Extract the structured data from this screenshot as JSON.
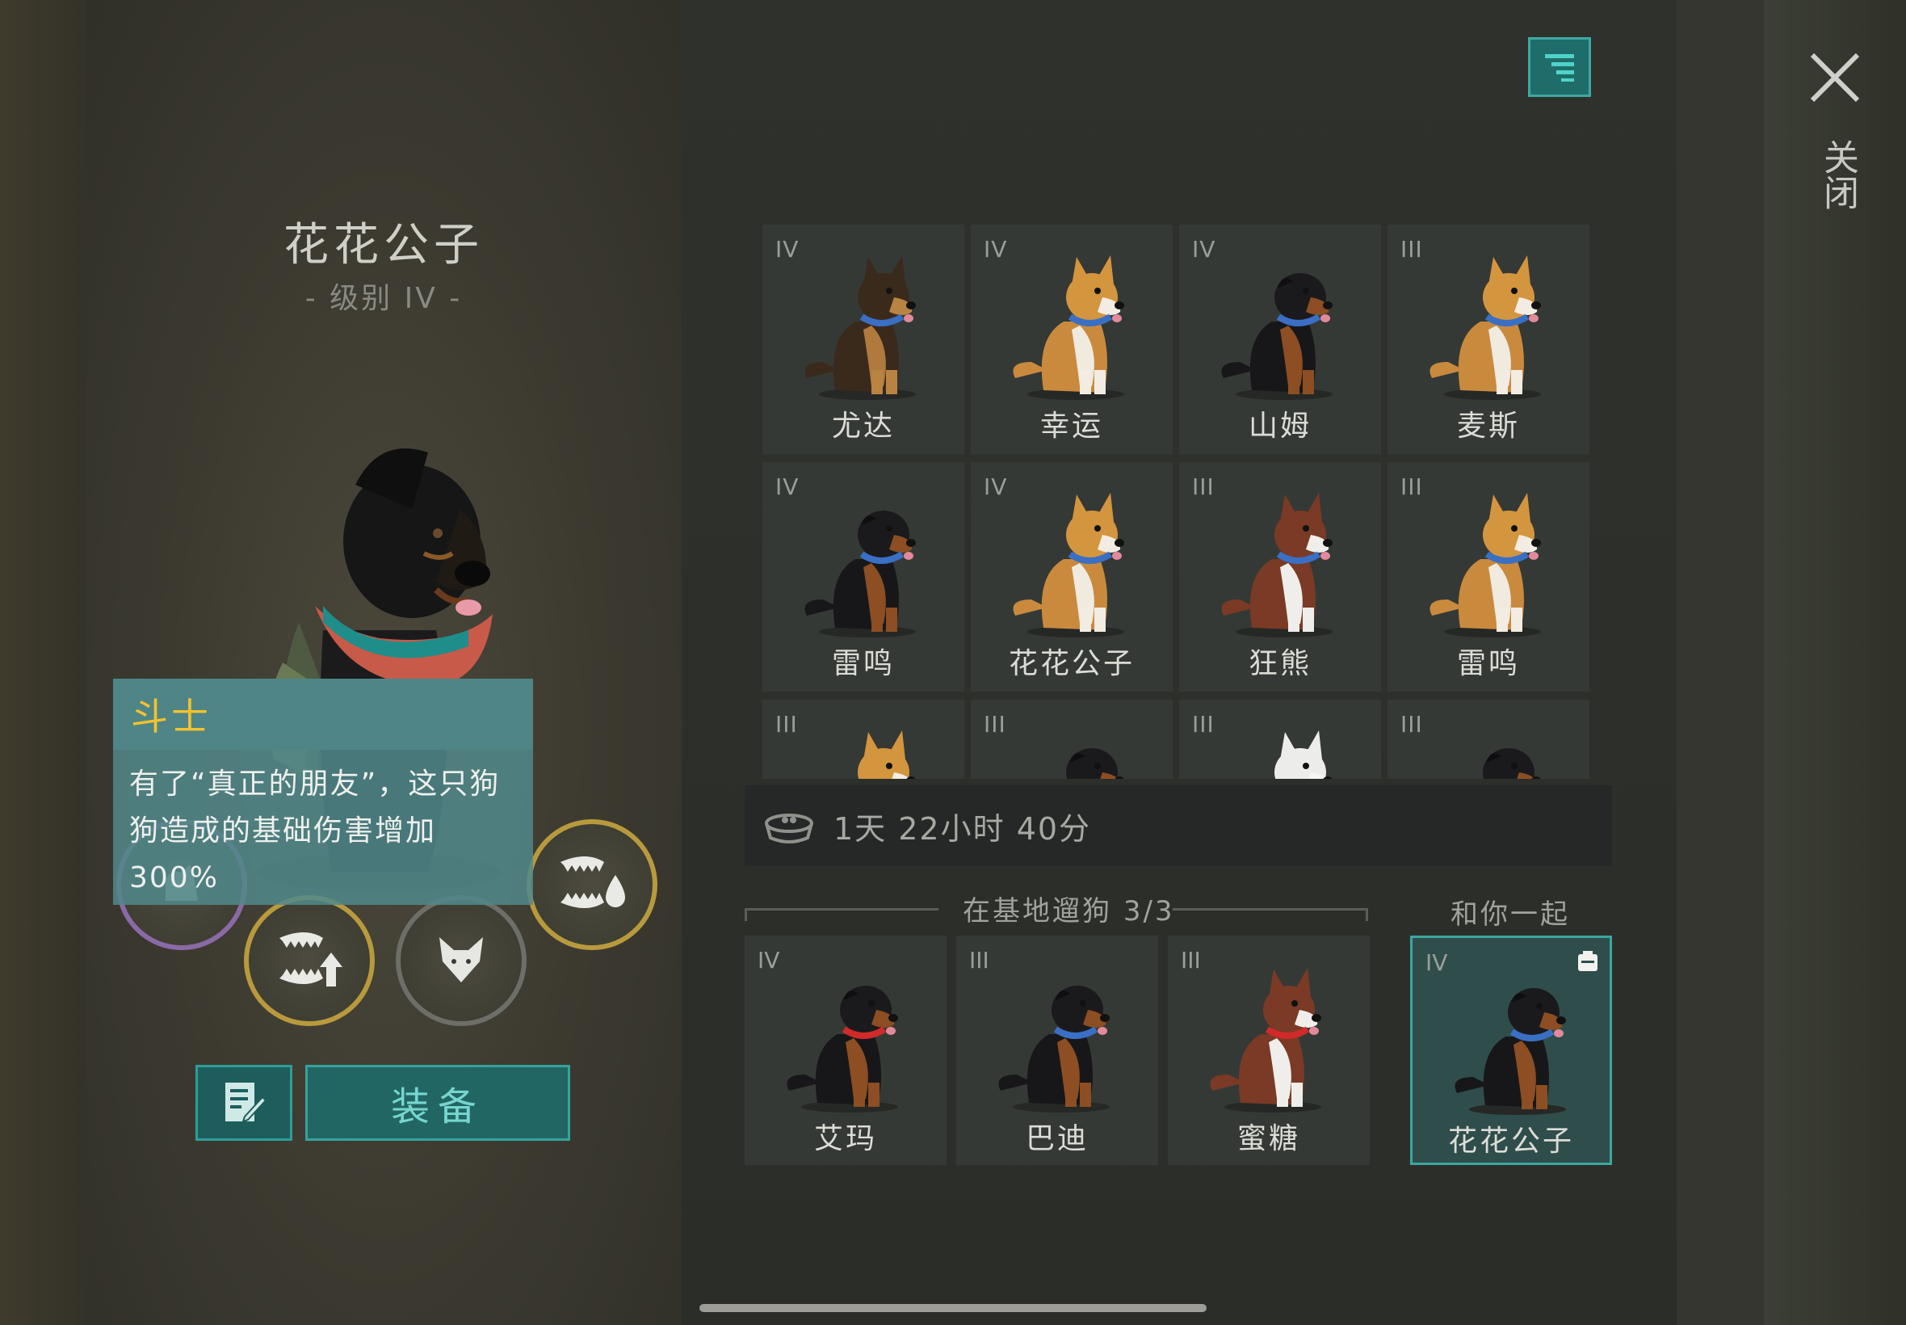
{
  "selected_dog": {
    "name": "花花公子",
    "level": "- 级别 IV -",
    "trait_title": "斗士",
    "trait_desc_line1": "有了“真正的朋友”，这只狗",
    "trait_desc_line2": "狗造成的基础伤害增加",
    "trait_desc_line3": "300%",
    "equip_label": "装备",
    "skills": [
      "fang-drop-icon",
      "fang-up-icon",
      "wolf-head-icon",
      "dog-figure-icon"
    ]
  },
  "close_label": "关闭",
  "grid": [
    {
      "tier": "IV",
      "name": "尤达",
      "breed": "shepherd",
      "collar": "#3a6fc4"
    },
    {
      "tier": "IV",
      "name": "幸运",
      "breed": "corgi",
      "collar": "#3a6fc4"
    },
    {
      "tier": "IV",
      "name": "山姆",
      "breed": "rottweiler",
      "collar": "#3a6fc4"
    },
    {
      "tier": "III",
      "name": "麦斯",
      "breed": "corgi",
      "collar": "#3a6fc4"
    },
    {
      "tier": "IV",
      "name": "雷鸣",
      "breed": "rottweiler",
      "collar": "#3a6fc4"
    },
    {
      "tier": "IV",
      "name": "花花公子",
      "breed": "corgi",
      "collar": "#3a6fc4"
    },
    {
      "tier": "III",
      "name": "狂熊",
      "breed": "husky",
      "collar": "#3a6fc4"
    },
    {
      "tier": "III",
      "name": "雷鸣",
      "breed": "corgi",
      "collar": "#3a6fc4"
    },
    {
      "tier": "III",
      "name": "",
      "breed": "corgi",
      "collar": "#3a6fc4"
    },
    {
      "tier": "III",
      "name": "",
      "breed": "rottweiler",
      "collar": "#3a6fc4"
    },
    {
      "tier": "III",
      "name": "",
      "breed": "white",
      "collar": "#3a6fc4"
    },
    {
      "tier": "III",
      "name": "",
      "breed": "rottweiler",
      "collar": "#3a6fc4"
    }
  ],
  "timer": "1天 22小时 40分",
  "base_section": {
    "label": "在基地遛狗",
    "count": "3/3"
  },
  "with_you_label": "和你一起",
  "base_dogs": [
    {
      "tier": "IV",
      "name": "艾玛",
      "breed": "rottweiler",
      "collar": "#d02a2a"
    },
    {
      "tier": "III",
      "name": "巴迪",
      "breed": "rottweiler",
      "collar": "#3a6fc4"
    },
    {
      "tier": "III",
      "name": "蜜糖",
      "breed": "husky",
      "collar": "#d02a2a"
    }
  ],
  "with_you_dog": {
    "tier": "IV",
    "name": "花花公子",
    "breed": "rottweiler",
    "collar": "#3a6fc4"
  },
  "colors": {
    "accent": "#3aa7a0",
    "trait_title": "#f4c22c",
    "skill_gold": "#b89a3d"
  }
}
